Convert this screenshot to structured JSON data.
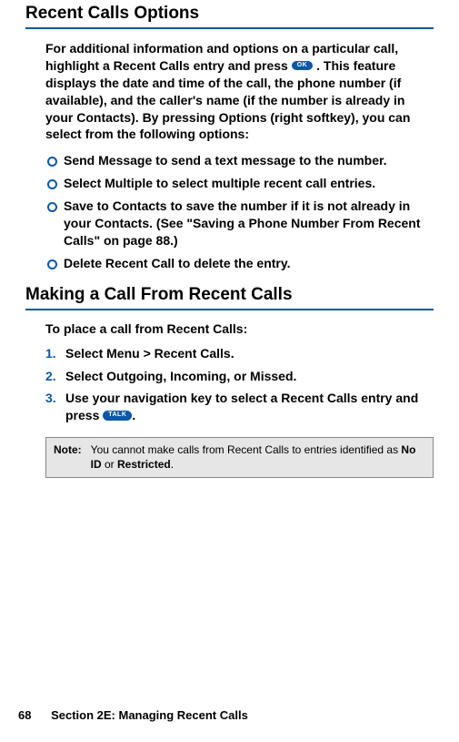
{
  "heading1": "Recent Calls Options",
  "intro_before_ok": "For additional information and options on a particular call, highlight a Recent Calls entry and press ",
  "ok_label": "OK",
  "intro_after_ok_before_options": ". This feature displays the date and time of the call, the phone number (if available), and the caller's name (if the number is already in your Contacts). By pressing ",
  "options_word": "Options",
  "intro_after_options": " (right softkey), you can select from the following options:",
  "bullets": [
    {
      "label": "Send Message",
      "rest": " to send a text message to the number."
    },
    {
      "label": "Select Multiple",
      "rest": " to select multiple recent call entries."
    },
    {
      "label": "Save to Contacts",
      "rest": " to save the number if it is not already in your Contacts. (See \"Saving a Phone Number From Recent Calls\" on page 88.)"
    },
    {
      "label": "Delete Recent Call",
      "rest": " to delete the entry."
    }
  ],
  "heading2": "Making a Call From Recent Calls",
  "subhead": "To place a call from Recent Calls:",
  "steps": {
    "s1_num": "1.",
    "s1_a": "Select ",
    "s1_b": "Menu",
    "s1_c": " > ",
    "s1_d": "Recent Calls",
    "s1_e": ".",
    "s2_num": "2.",
    "s2_a": "Select ",
    "s2_b": "Outgoing",
    "s2_c": ", ",
    "s2_d": "Incoming",
    "s2_e": ", or ",
    "s2_f": "Missed",
    "s2_g": ".",
    "s3_num": "3.",
    "s3_a": "Use your navigation key to select a Recent Calls entry and press ",
    "talk_label": "TALK",
    "s3_b": "."
  },
  "note": {
    "label": "Note:",
    "a": "You cannot make calls from Recent Calls to entries identified as ",
    "b": "No ID",
    "c": " or ",
    "d": "Restricted",
    "e": "."
  },
  "footer": {
    "page": "68",
    "section": "Section 2E: Managing Recent Calls"
  }
}
